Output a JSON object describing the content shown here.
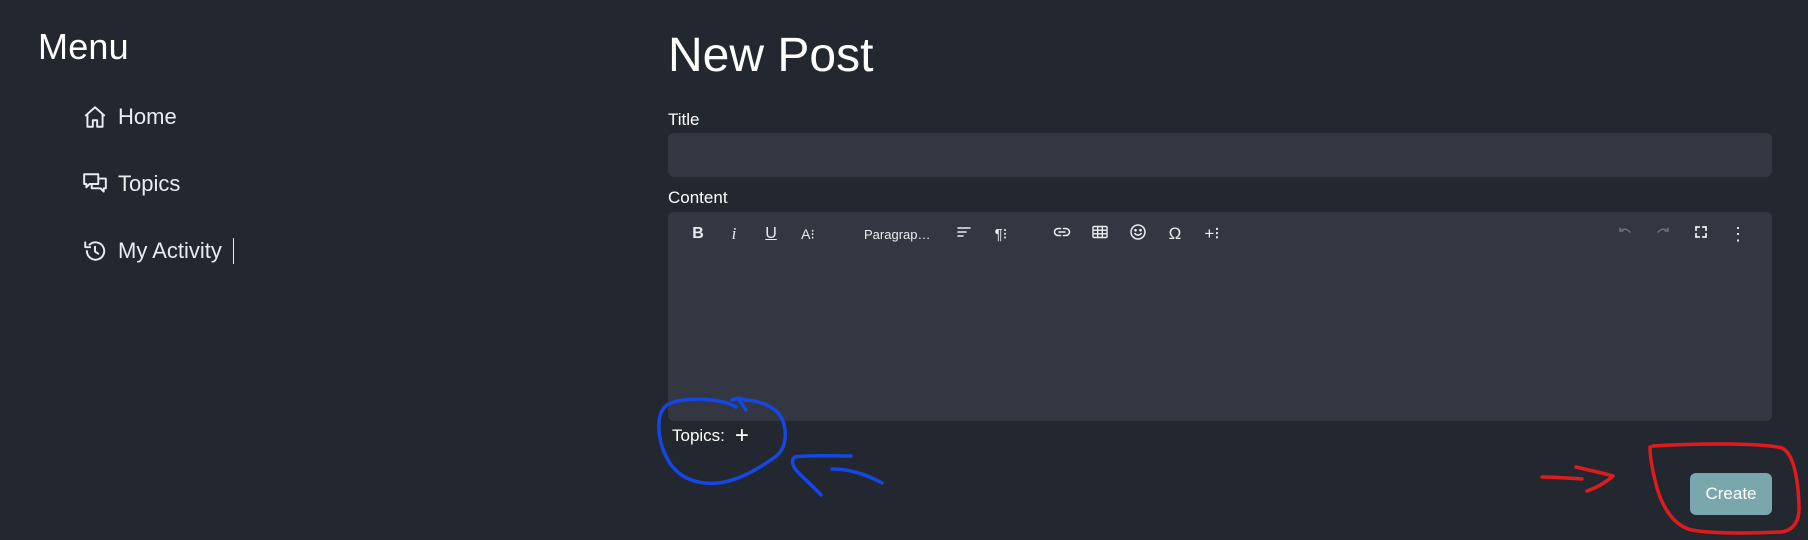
{
  "sidebar": {
    "title": "Menu",
    "items": [
      {
        "label": "Home",
        "icon": "home-icon"
      },
      {
        "label": "Topics",
        "icon": "chat-bubbles-icon"
      },
      {
        "label": "My Activity",
        "icon": "history-icon"
      }
    ]
  },
  "main": {
    "title": "New Post",
    "title_field": {
      "label": "Title",
      "value": "",
      "placeholder": ""
    },
    "content_field": {
      "label": "Content",
      "value": ""
    },
    "toolbar": {
      "bold": "B",
      "italic": "i",
      "underline": "U",
      "text_size": "A⁝",
      "paragraph": "Paragrap…",
      "pilcrow": "¶⁝",
      "omega": "Ω",
      "insert": "+⁝",
      "more": "⋮"
    },
    "topics": {
      "label": "Topics:",
      "add": "+"
    },
    "create_label": "Create"
  },
  "colors": {
    "background": "#232730",
    "input_background": "#333741",
    "create_button": "#7aa7ab",
    "annotation_blue": "#1447e6",
    "annotation_red": "#e01b1b"
  }
}
